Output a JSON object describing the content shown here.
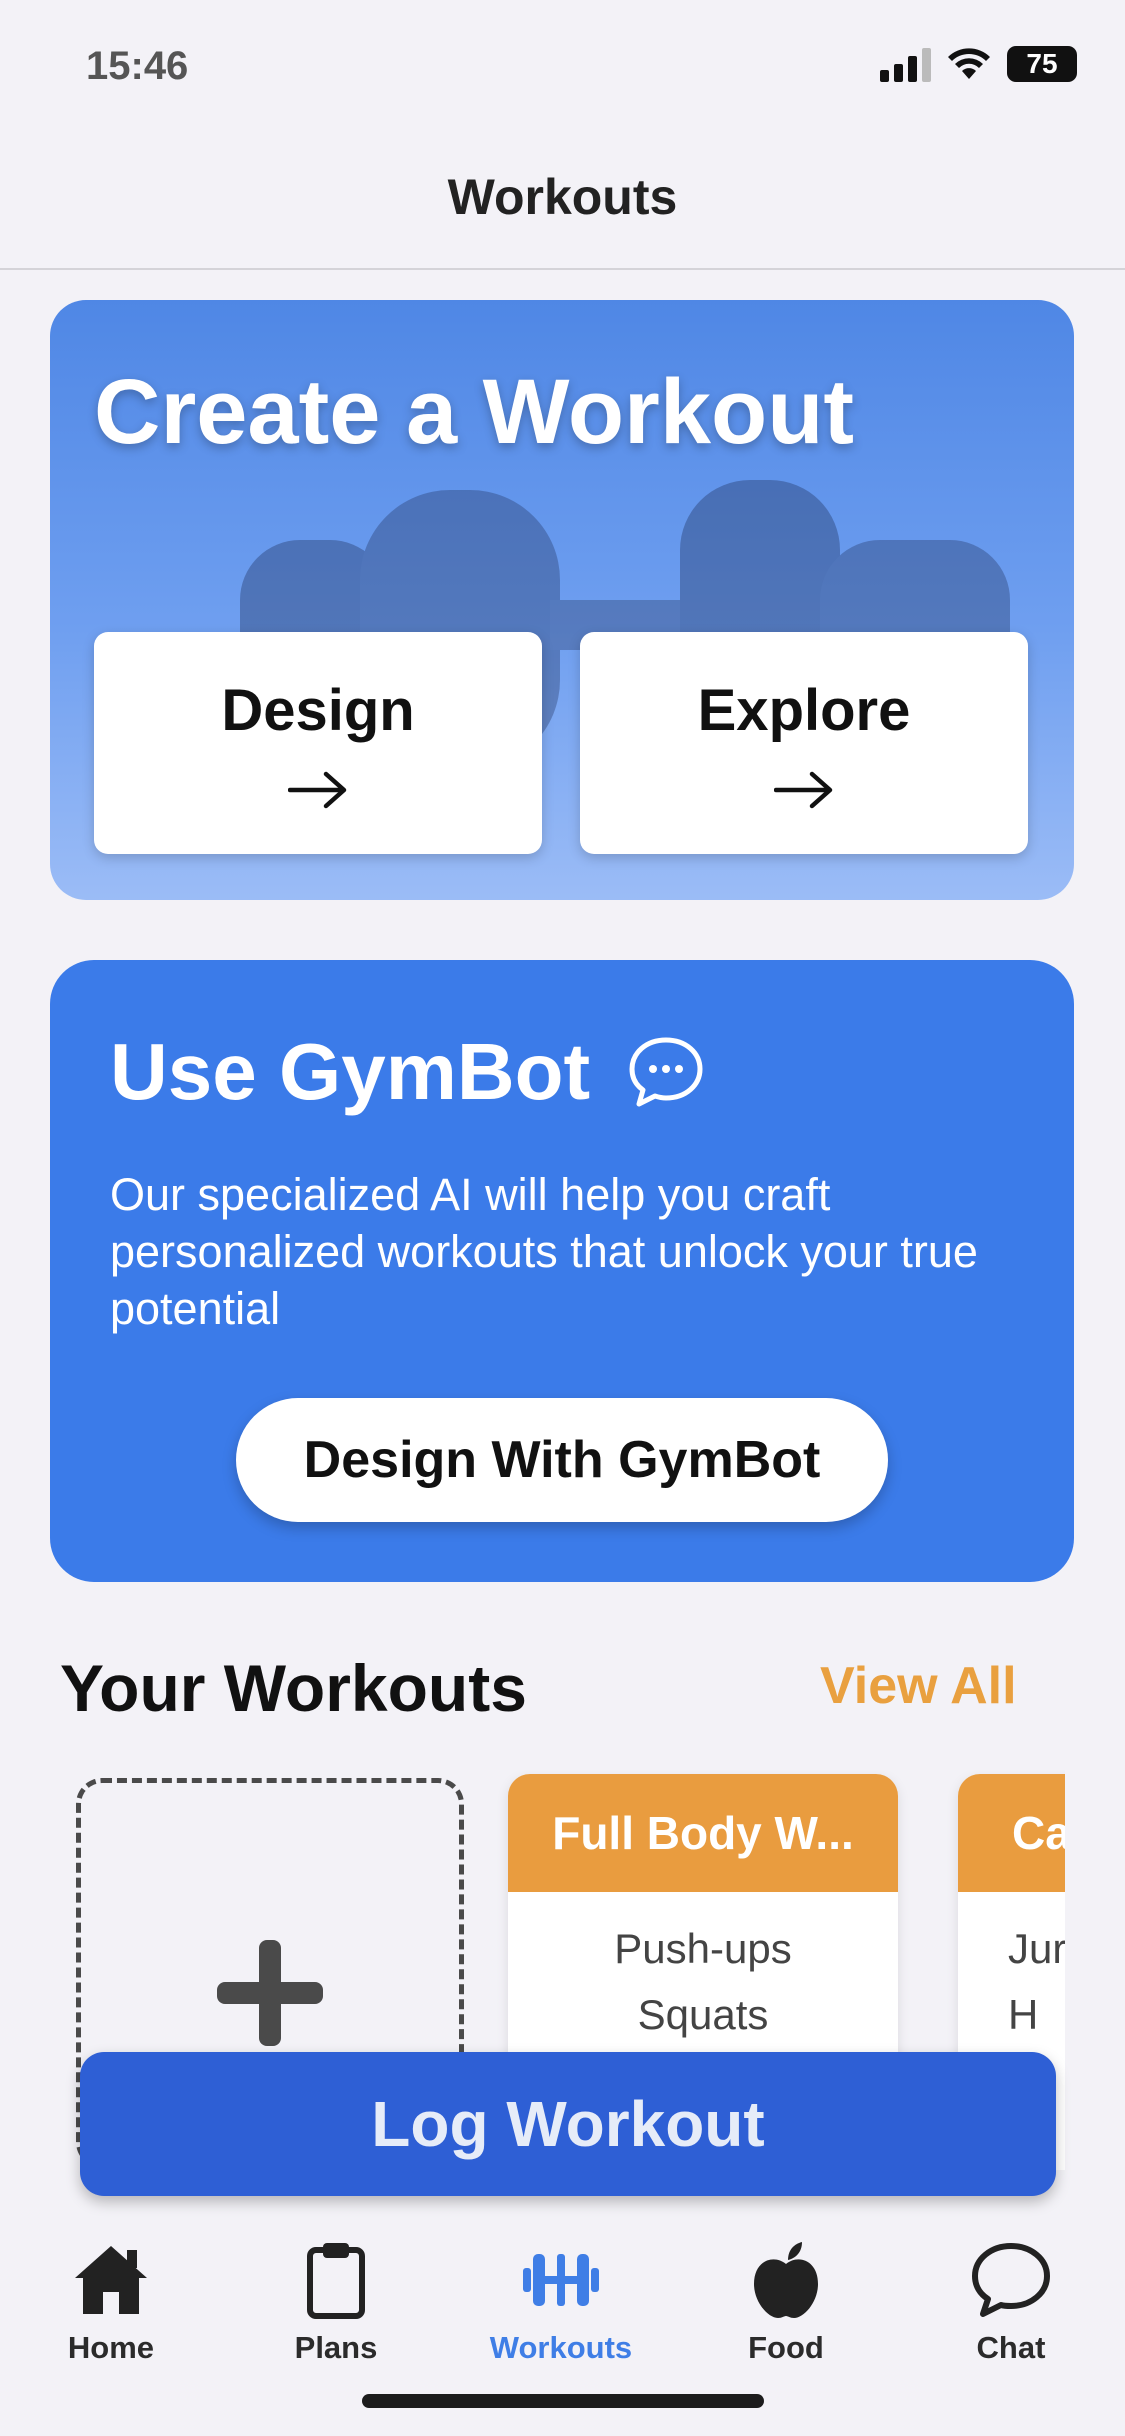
{
  "status_bar": {
    "time": "15:46",
    "battery": "75"
  },
  "header": {
    "title": "Workouts"
  },
  "create_card": {
    "title": "Create a Workout",
    "design_label": "Design",
    "explore_label": "Explore"
  },
  "gymbot": {
    "title": "Use GymBot",
    "description": "Our specialized AI will help you craft personalized workouts that unlock your true potential",
    "button_label": "Design With GymBot"
  },
  "your_workouts": {
    "title": "Your Workouts",
    "view_all": "View All",
    "cards": [
      {
        "title": "Full Body W...",
        "exercises": [
          "Push-ups",
          "Squats"
        ]
      },
      {
        "title": "Ca",
        "exercises": [
          "Jur",
          "H"
        ]
      }
    ]
  },
  "log_workout": {
    "label": "Log Workout"
  },
  "tab_bar": {
    "items": [
      {
        "label": "Home",
        "icon": "home-icon"
      },
      {
        "label": "Plans",
        "icon": "clipboard-icon"
      },
      {
        "label": "Workouts",
        "icon": "dumbbell-icon",
        "active": true
      },
      {
        "label": "Food",
        "icon": "apple-icon"
      },
      {
        "label": "Chat",
        "icon": "chat-bubble-icon"
      }
    ]
  },
  "colors": {
    "accent_blue": "#3b7be9",
    "log_button_blue": "#2e5fd5",
    "orange": "#e99c3f",
    "active_tab": "#3f7ee6"
  }
}
